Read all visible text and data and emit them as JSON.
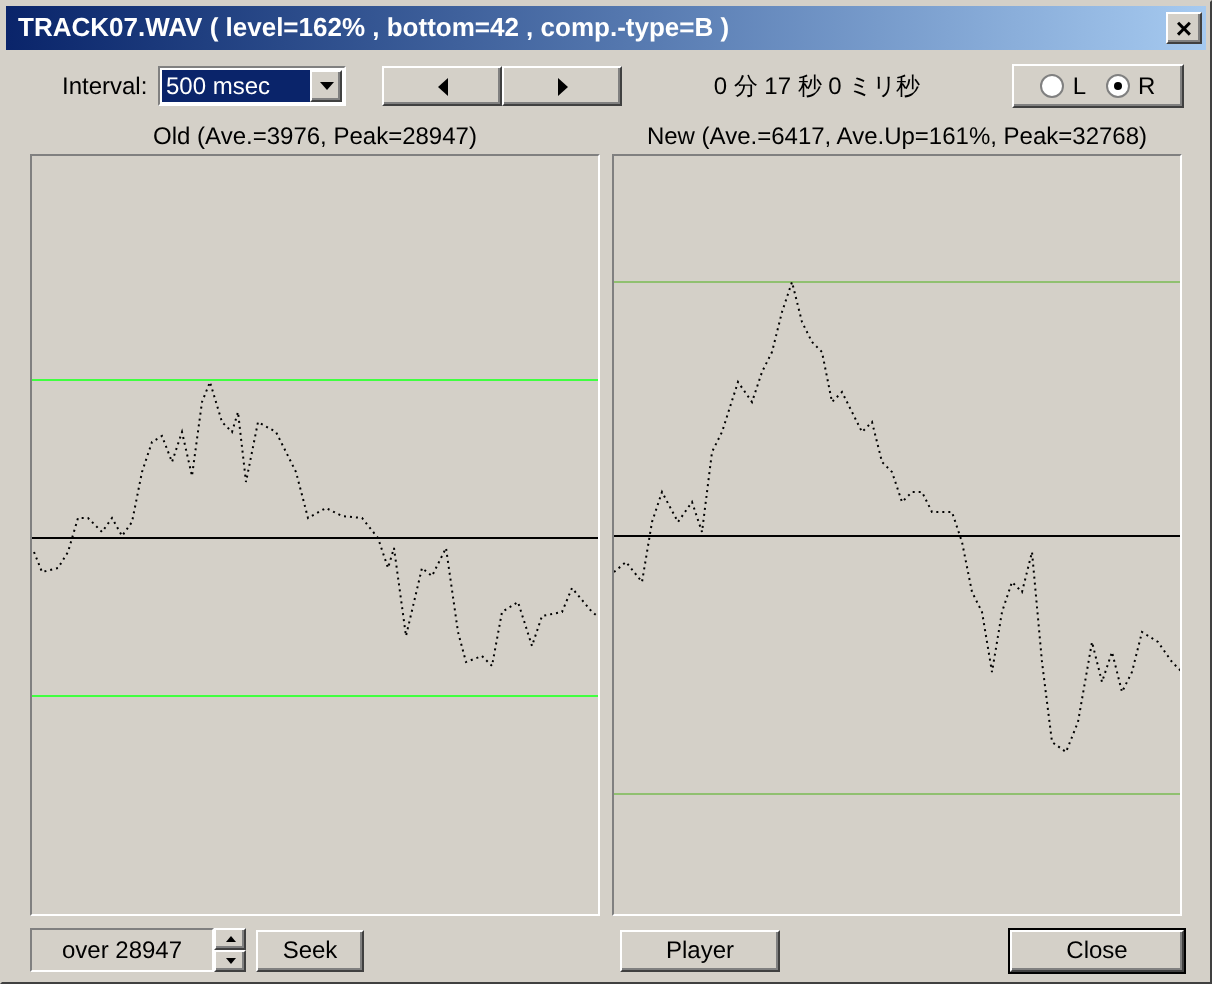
{
  "window": {
    "title": "TRACK07.WAV ( level=162% , bottom=42 , comp.-type=B )",
    "close": "×"
  },
  "toolbar": {
    "interval_label": "Interval:",
    "interval_value": "500 msec",
    "position": "0 分 17 秒 0 ミリ秒",
    "channels": [
      {
        "label": "L",
        "selected": false
      },
      {
        "label": "R",
        "selected": true
      }
    ]
  },
  "panels": [
    {
      "title": "Old  (Ave.=3976, Peak=28947)",
      "kind": "old"
    },
    {
      "title": "New  (Ave.=6417, Ave.Up=161%, Peak=32768)",
      "kind": "new"
    }
  ],
  "footer": {
    "threshold_value": "over 28947",
    "seek": "Seek",
    "player": "Player",
    "close": "Close"
  }
}
